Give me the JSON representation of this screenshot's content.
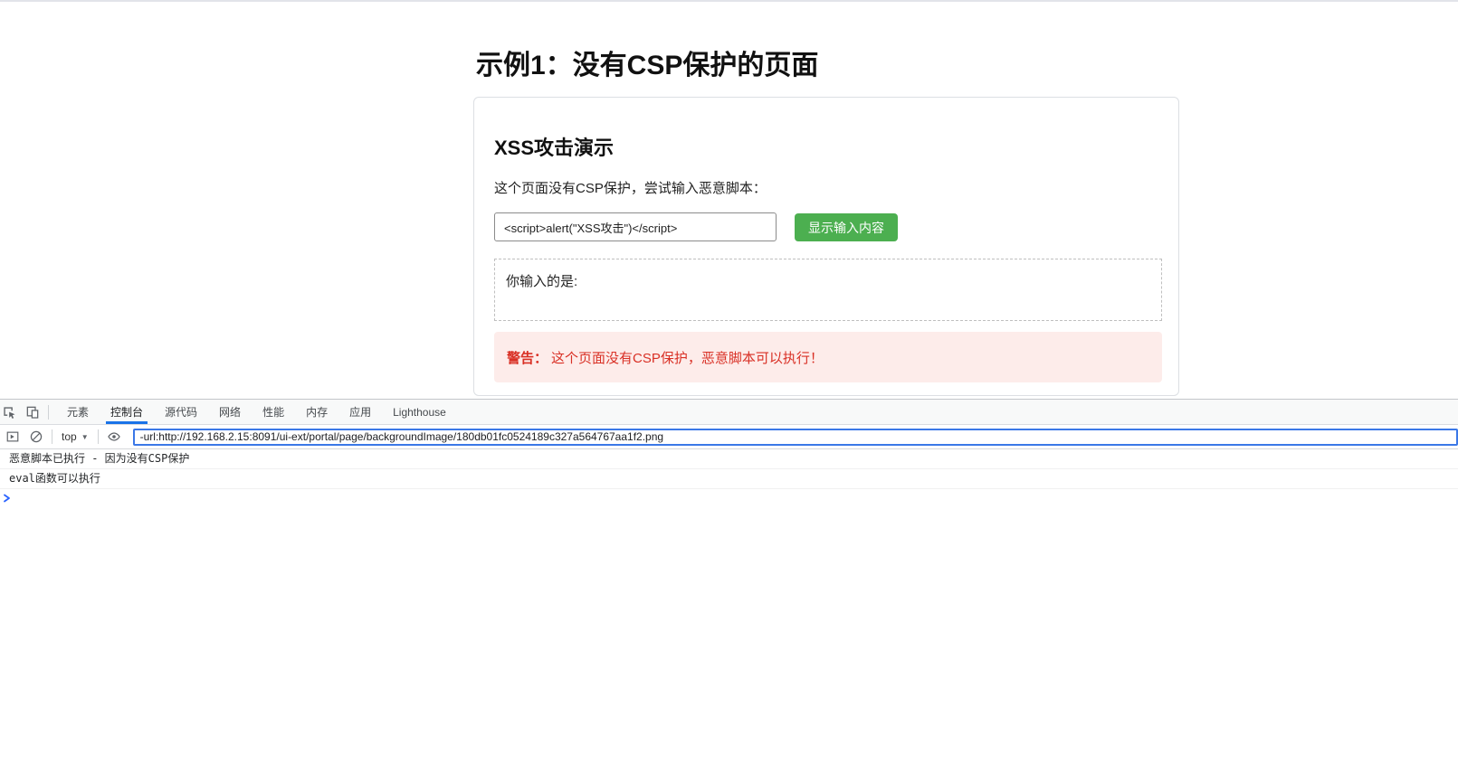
{
  "page": {
    "title": "示例1：没有CSP保护的页面",
    "card": {
      "heading": "XSS攻击演示",
      "description": "这个页面没有CSP保护，尝试输入恶意脚本：",
      "input_value": "<script>alert(\"XSS攻击\")</script>",
      "button_label": "显示输入内容",
      "output_label": "你输入的是:",
      "warning_prefix": "警告：",
      "warning_text": "这个页面没有CSP保护，恶意脚本可以执行！"
    }
  },
  "devtools": {
    "tabs": [
      "元素",
      "控制台",
      "源代码",
      "网络",
      "性能",
      "内存",
      "应用",
      "Lighthouse"
    ],
    "selected_tab": "控制台",
    "context_selector": "top",
    "filter_value": "-url:http://192.168.2.15:8091/ui-ext/portal/page/backgroundImage/180db01fc0524189c327a564767aa1f2.png",
    "console_messages": [
      "恶意脚本已执行 - 因为没有CSP保护",
      "eval函数可以执行"
    ],
    "icons": {
      "inspect": "inspect-cursor-icon",
      "device_toolbar": "device-toolbar-icon",
      "console_sidebar": "console-sidebar-icon",
      "clear_console": "clear-console-icon",
      "live_expression": "eye-icon",
      "dropdown_arrow": "▼",
      "prompt": "chevron-right-icon"
    }
  },
  "colors": {
    "button_green": "#4caf50",
    "warning_bg": "#fdecea",
    "warning_text": "#d93025",
    "tab_underline": "#1a73e8",
    "filter_border": "#3b78e7",
    "prompt_blue": "#2962ff"
  }
}
